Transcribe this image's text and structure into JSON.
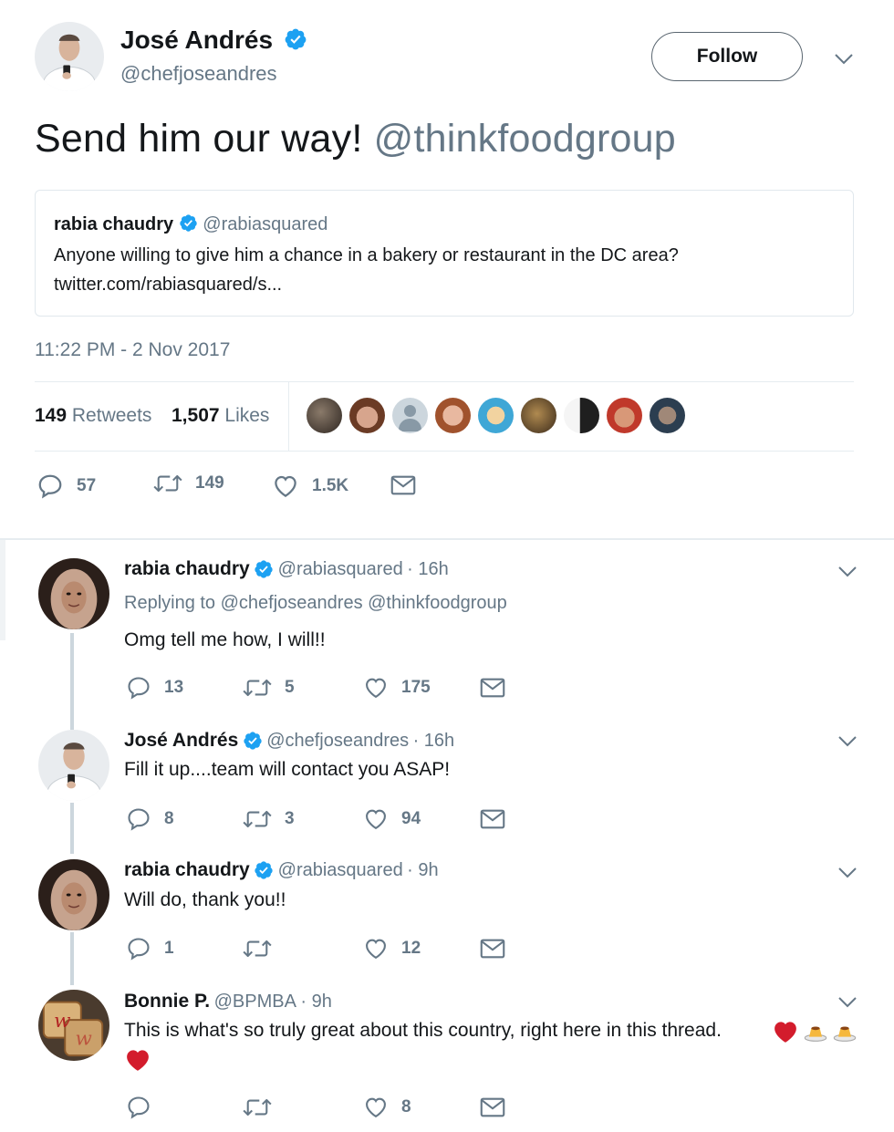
{
  "main_tweet": {
    "author_name": "José Andrés",
    "author_handle": "@chefjoseandres",
    "follow_label": "Follow",
    "text_plain": "Send him our way! ",
    "text_mention": "@thinkfoodgroup",
    "quote": {
      "author_name": "rabia chaudry",
      "author_handle": "@rabiasquared",
      "text": "Anyone willing to give him a chance in a bakery or restaurant in the DC area?",
      "link": "twitter.com/rabiasquared/s..."
    },
    "timestamp": "11:22 PM - 2 Nov 2017",
    "stats": {
      "retweets_count": "149",
      "retweets_label": "Retweets",
      "likes_count": "1,507",
      "likes_label": "Likes"
    },
    "actions": {
      "replies": "57",
      "retweets": "149",
      "likes": "1.5K"
    }
  },
  "replies": [
    {
      "author_name": "rabia chaudry",
      "author_handle": "@rabiasquared",
      "time": "· 16h",
      "replying_to_label": "Replying to",
      "replying_to_handles": "@chefjoseandres @thinkfoodgroup",
      "text": "Omg tell me how, I will!!",
      "replies": "13",
      "retweets": "5",
      "likes": "175"
    },
    {
      "author_name": "José Andrés",
      "author_handle": "@chefjoseandres",
      "time": "· 16h",
      "text": "Fill it up....team will contact you ASAP!",
      "replies": "8",
      "retweets": "3",
      "likes": "94"
    },
    {
      "author_name": "rabia chaudry",
      "author_handle": "@rabiasquared",
      "time": "· 9h",
      "text": "Will do, thank you!!",
      "replies": "1",
      "retweets": "",
      "likes": "12"
    },
    {
      "author_name": "Bonnie P.",
      "author_handle": "@BPMBA",
      "time": "· 9h",
      "text": "This is what's so truly great about this country, right here in this thread.",
      "replies": "",
      "retweets": "",
      "likes": "8"
    }
  ],
  "colors": {
    "verified_blue": "#1da1f2",
    "muted_gray": "#657786",
    "heart_red": "#d31c2c"
  }
}
